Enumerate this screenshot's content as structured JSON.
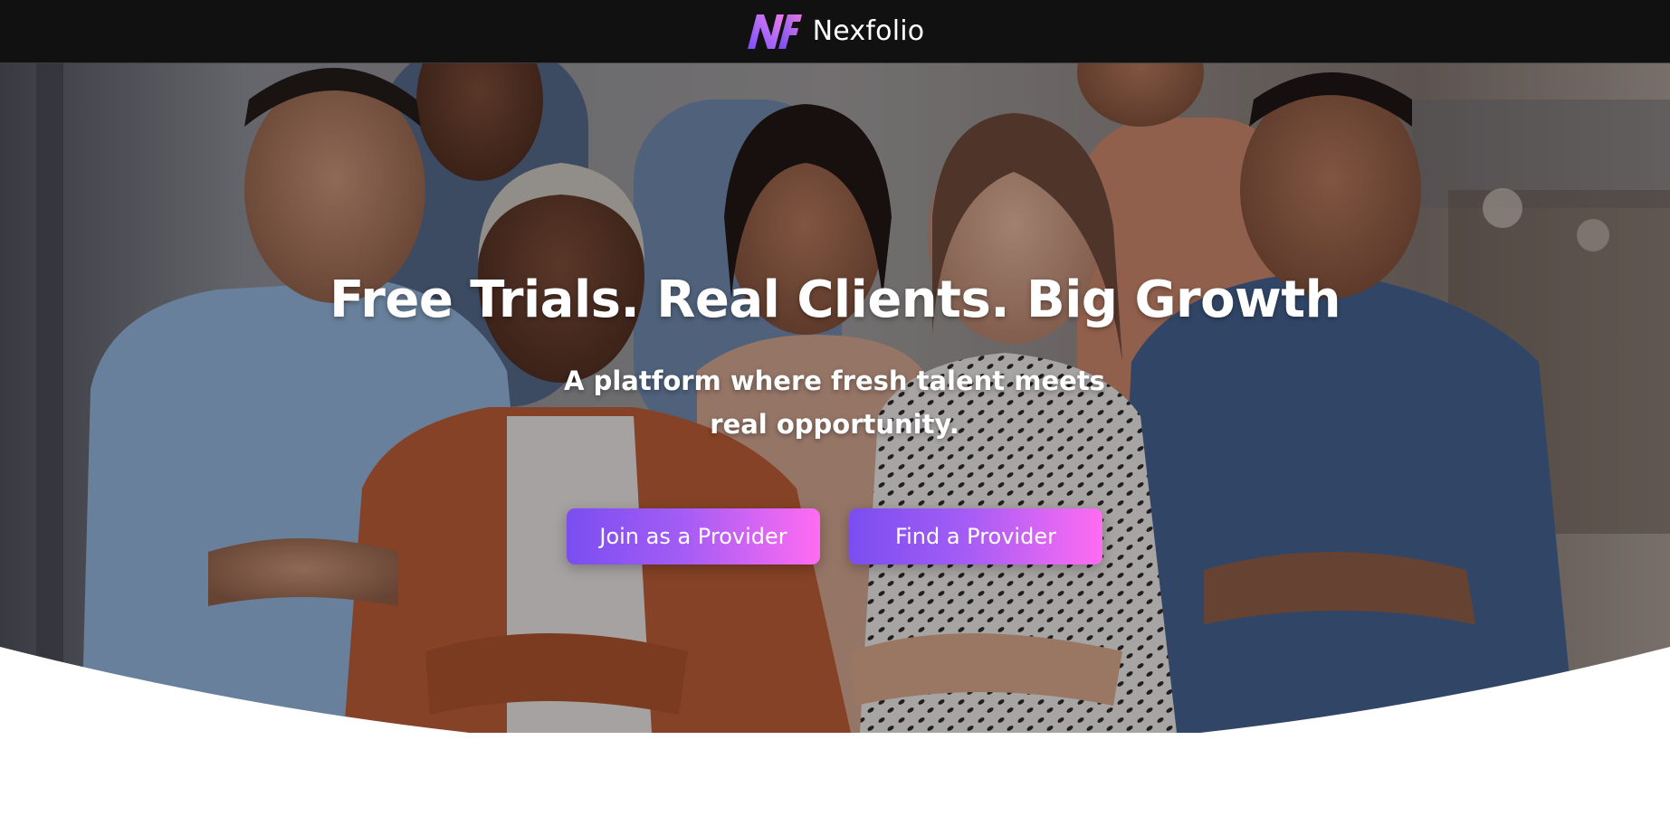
{
  "header": {
    "brand_name": "Nexfolio",
    "logo_icon": "nf-monogram-icon",
    "colors": {
      "background": "#111111",
      "logo_gradient_start": "#8b5cf6",
      "logo_gradient_end": "#f472e8"
    }
  },
  "hero": {
    "background_image": "team-group-photo",
    "title": "Free Trials. Real Clients. Big Growth",
    "subtitle": "A platform where fresh talent meets real opportunity.",
    "buttons": [
      {
        "label": "Join as a Provider"
      },
      {
        "label": "Find a Provider"
      }
    ],
    "colors": {
      "button_gradient_start": "#7b4ef0",
      "button_gradient_end": "#ff6cf2",
      "text": "#ffffff"
    }
  }
}
